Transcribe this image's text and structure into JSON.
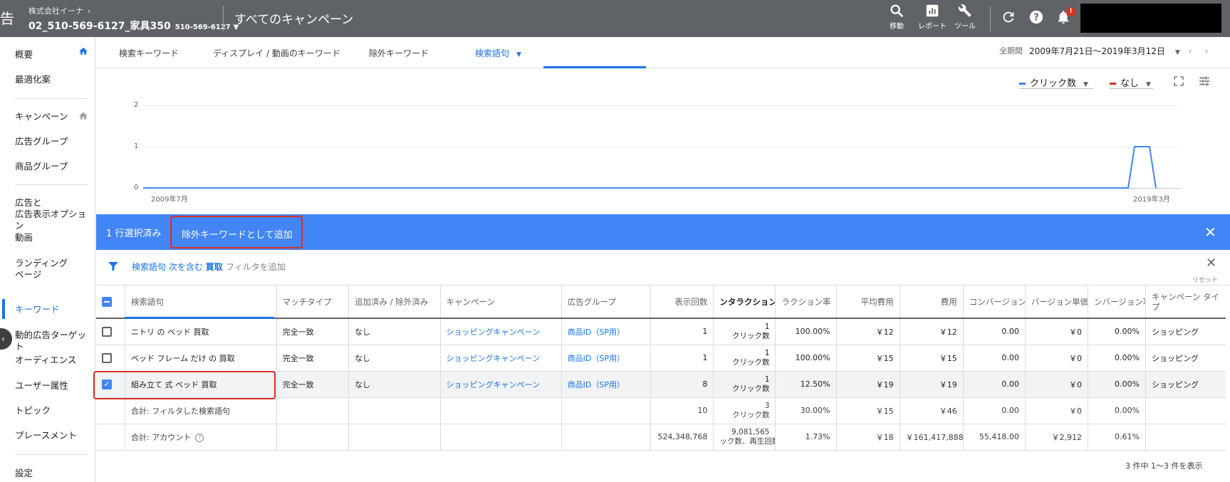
{
  "header": {
    "brand_fragment": "告",
    "company": "株式会社イーナ",
    "account_name": "02_510-569-6127_家具350",
    "account_id": "510-569-6127",
    "page_title": "すべてのキャンペーン",
    "tools": {
      "search": "移動",
      "reports": "レポート",
      "tools": "ツール"
    },
    "bell_badge": "!"
  },
  "sidebar": {
    "overview": "概要",
    "optimization": "最適化案",
    "campaigns": "キャンペーン",
    "ad_groups": "広告グループ",
    "product_groups": "商品グループ",
    "ads_line1": "広告と",
    "ads_line2": "広告表示オプション",
    "video": "動画",
    "landing_line1": "ランディング",
    "landing_line2": "ページ",
    "keywords": "キーワード",
    "dynamic_targets": "動的広告ターゲット",
    "audiences": "オーディエンス",
    "demographics": "ユーザー属性",
    "topics": "トピック",
    "placements": "プレースメント",
    "settings": "設定"
  },
  "tabs": {
    "search_keywords": "検索キーワード",
    "display_video_keywords": "ディスプレイ / 動画のキーワード",
    "negative_keywords": "除外キーワード",
    "search_terms": "検索語句"
  },
  "date_range": {
    "label": "全期間",
    "value": "2009年7月21日～2019年3月12日"
  },
  "chart_data": {
    "type": "line",
    "x_tick_labels": [
      "2009年7月",
      "2019年3月"
    ],
    "y_tick_labels": [
      "0",
      "1",
      "2"
    ],
    "ylim": [
      0,
      2
    ],
    "series": [
      {
        "name": "クリック数",
        "color": "#4285f4",
        "x": [
          "2009年7月",
          "2019年3月"
        ],
        "values": [
          0,
          1
        ]
      }
    ],
    "secondary_metric": "なし",
    "grid": true
  },
  "chart_controls": {
    "metric1": "クリック数",
    "metric2": "なし",
    "expand_label": "展開",
    "metric1_color": "#4285f4",
    "metric2_color": "#d93025"
  },
  "selection": {
    "count_label": "1 行選択済み",
    "action_label": "除外キーワードとして追加"
  },
  "filter": {
    "field": "検索語句",
    "op": "次を含む",
    "value": "買取",
    "add_label": "フィルタを追加",
    "reset_label": "リセット"
  },
  "table": {
    "columns": [
      "検索語句",
      "マッチタイプ",
      "追加済み / 除外済み",
      "キャンペーン",
      "広告グループ",
      "表示回数",
      "ンタラクション",
      "ラクション率",
      "平均費用",
      "費用",
      "コンバージョン",
      "バージョン単価",
      "ンバージョン率",
      "キャンペーン タイプ"
    ],
    "rows": [
      {
        "term": "ニトリ の ベッド 買取",
        "match": "完全一致",
        "added": "なし",
        "campaign": "ショッピングキャンペーン",
        "ad_group": "商品ID（SP用）",
        "impressions": "1",
        "interactions_num": "1",
        "interactions_unit": "クリック数",
        "rate": "100.00%",
        "avg_cost": "￥12",
        "cost": "￥12",
        "conversions": "0.00",
        "cost_per_conv": "￥0",
        "conv_rate": "0.00%",
        "campaign_type": "ショッピング"
      },
      {
        "term": "ベッド フレーム だけ の 買取",
        "match": "完全一致",
        "added": "なし",
        "campaign": "ショッピングキャンペーン",
        "ad_group": "商品ID（SP用）",
        "impressions": "1",
        "interactions_num": "1",
        "interactions_unit": "クリック数",
        "rate": "100.00%",
        "avg_cost": "￥15",
        "cost": "￥15",
        "conversions": "0.00",
        "cost_per_conv": "￥0",
        "conv_rate": "0.00%",
        "campaign_type": "ショッピング"
      },
      {
        "term": "組み立て 式 ベッド 買取",
        "match": "完全一致",
        "added": "なし",
        "campaign": "ショッピングキャンペーン",
        "ad_group": "商品ID（SP用）",
        "impressions": "8",
        "interactions_num": "1",
        "interactions_unit": "クリック数",
        "rate": "12.50%",
        "avg_cost": "￥19",
        "cost": "￥19",
        "conversions": "0.00",
        "cost_per_conv": "￥0",
        "conv_rate": "0.00%",
        "campaign_type": "ショッピング"
      }
    ],
    "totals": [
      {
        "label": "合計: フィルタした検索語句",
        "impressions": "10",
        "interactions_num": "3",
        "interactions_unit": "クリック数",
        "rate": "30.00%",
        "avg_cost": "￥15",
        "cost": "￥46",
        "conversions": "0.00",
        "cost_per_conv": "￥0",
        "conv_rate": "0.00%"
      },
      {
        "label": "合計: アカウント",
        "impressions": "524,348,768",
        "interactions_num": "9,081,565",
        "interactions_unit": "ック数、再生回数",
        "rate": "1.73%",
        "avg_cost": "￥18",
        "cost": "￥161,417,888",
        "conversions": "55,418.00",
        "cost_per_conv": "￥2,912",
        "conv_rate": "0.61%"
      }
    ]
  },
  "pagination": "3 件中 1〜3 件を表示"
}
